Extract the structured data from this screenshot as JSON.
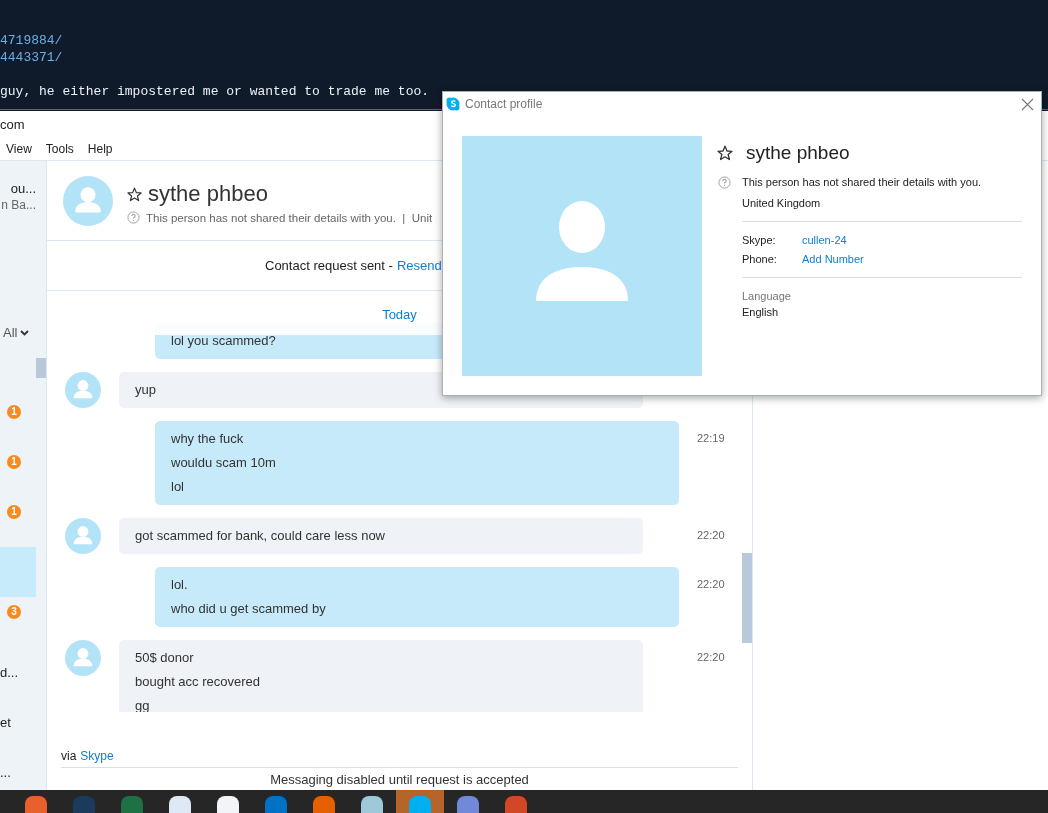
{
  "terminal": {
    "lines": [
      {
        "kind": "link",
        "text": "4719884/"
      },
      {
        "kind": "link",
        "text": "4443371/"
      },
      {
        "kind": "text",
        "text": "guy, he either impostered me or wanted to trade me too."
      }
    ]
  },
  "window": {
    "title": "com",
    "menu": [
      "View",
      "Tools",
      "Help"
    ]
  },
  "sidebar": {
    "header_lines": [
      "ou...",
      "n Ba..."
    ],
    "filter": "All",
    "contacts": [
      {
        "selected": false,
        "badge": "1"
      },
      {
        "selected": false,
        "badge": "1"
      },
      {
        "selected": false,
        "badge": "1"
      },
      {
        "selected": true
      },
      {
        "selected": false,
        "badge": "3"
      },
      {
        "selected": false,
        "name": "d..."
      },
      {
        "selected": false,
        "name": "et"
      },
      {
        "selected": false,
        "name": "..."
      }
    ]
  },
  "chat": {
    "contact": {
      "name": "sythe phbeo",
      "status": "This person has not shared their details with you.  |  Unit"
    },
    "request": {
      "text": "Contact request sent -",
      "link": "Resend"
    },
    "day": "Today",
    "messages": [
      {
        "kind": "outgoing",
        "lines": [
          "lol you scammed?"
        ]
      },
      {
        "kind": "incoming",
        "lines": [
          "yup"
        ]
      },
      {
        "kind": "outgoing",
        "time": "22:19",
        "lines": [
          "why the fuck",
          "wouldu scam 10m",
          "lol"
        ]
      },
      {
        "kind": "incoming",
        "time": "22:20",
        "lines": [
          "got scammed for bank, could care less now"
        ]
      },
      {
        "kind": "outgoing",
        "time": "22:20",
        "lines": [
          "lol.",
          "who did u get scammed by"
        ]
      },
      {
        "kind": "incoming",
        "time": "22:20",
        "lines": [
          "50$ donor",
          "bought acc recovered",
          "gg"
        ]
      }
    ],
    "via": {
      "text": "via",
      "link": "Skype"
    },
    "notice": "Messaging disabled until request is accepted"
  },
  "profile": {
    "title": "Contact profile",
    "name": "sythe phbeo",
    "note": "This person has not shared their details with you.",
    "location": "United Kingdom",
    "fields": [
      {
        "label": "Skype:",
        "value": "cullen-24"
      },
      {
        "label": "Phone:",
        "value": "Add Number"
      }
    ],
    "language": {
      "label": "Language",
      "value": "English"
    }
  },
  "taskbar": {
    "apps": [
      {
        "color": "#e8612c",
        "selected": false
      },
      {
        "color": "#1b3a5c",
        "selected": false
      },
      {
        "color": "#1e7145",
        "selected": false
      },
      {
        "color": "#dfe9f5",
        "selected": false
      },
      {
        "color": "#f2f4f8",
        "selected": false
      },
      {
        "color": "#0072c6",
        "selected": false
      },
      {
        "color": "#e66000",
        "selected": false
      },
      {
        "color": "#9ec9d9",
        "selected": false
      },
      {
        "color": "#00aff0",
        "selected": true
      },
      {
        "color": "#7289da",
        "selected": false
      },
      {
        "color": "#d24726",
        "selected": false
      }
    ]
  }
}
